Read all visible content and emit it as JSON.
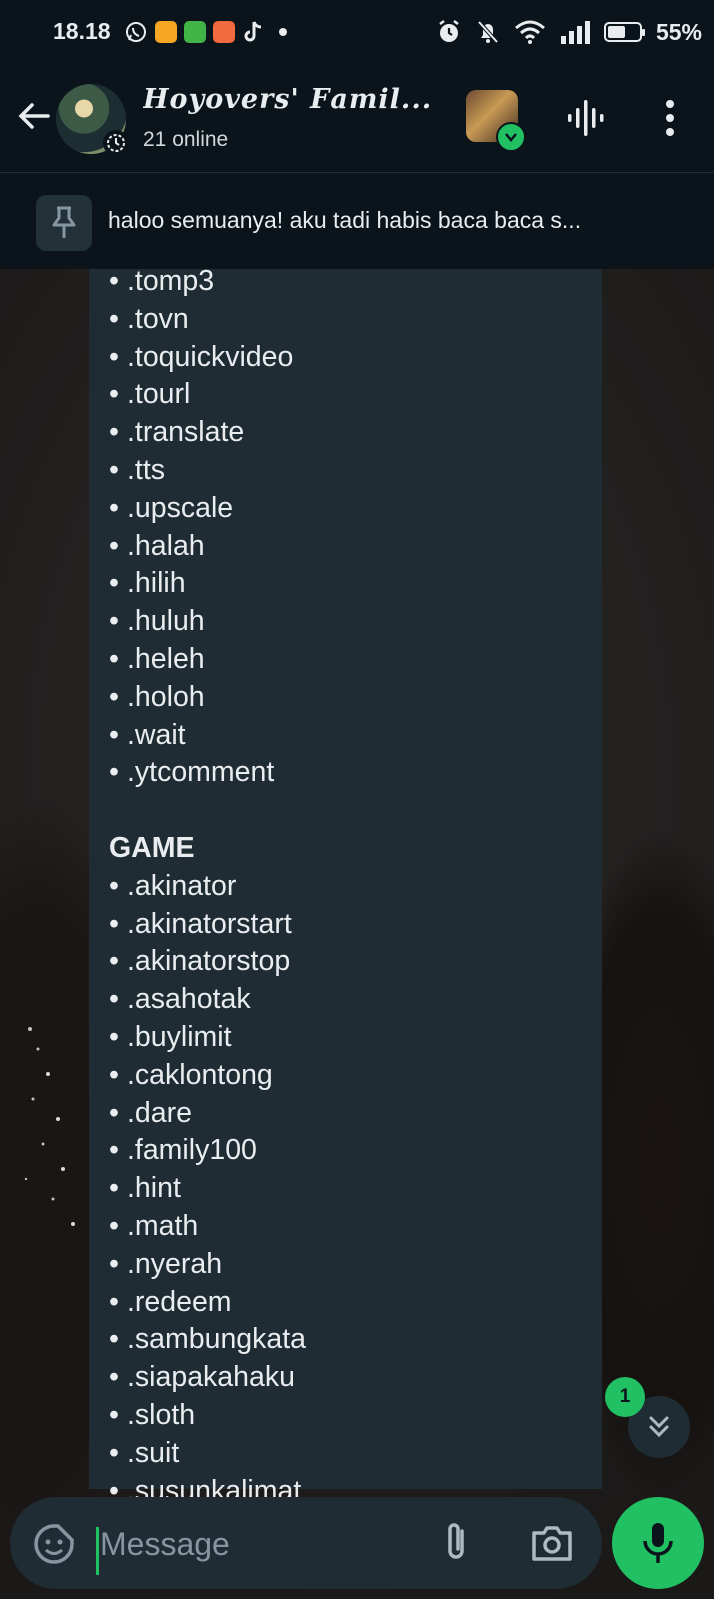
{
  "status_bar": {
    "time": "18.18",
    "battery": "55%",
    "app_icons": [
      "whatsapp-icon",
      "shopee-icon",
      "tokopedia-icon",
      "game-app-icon",
      "tiktok-icon"
    ],
    "right_icons": [
      "alarm-icon",
      "bell-off-icon",
      "wifi-icon",
      "signal-icon",
      "battery-icon"
    ]
  },
  "header": {
    "title": "𝑯oyovers' 𝑭amil...",
    "subtitle": "21 online"
  },
  "pinned": {
    "text": "haloo semuanya! aku tadi habis baca baca s..."
  },
  "message": {
    "lines": [
      {
        "text": ".tomp3",
        "bullet": "•"
      },
      {
        "text": ".tovn",
        "bullet": "•"
      },
      {
        "text": ".toquickvideo",
        "bullet": "•"
      },
      {
        "text": ".tourl",
        "bullet": "•"
      },
      {
        "text": ".translate",
        "bullet": "•"
      },
      {
        "text": ".tts",
        "bullet": "•"
      },
      {
        "text": ".upscale",
        "bullet": "•"
      },
      {
        "text": ".halah",
        "bullet": "•"
      },
      {
        "text": ".hilih",
        "bullet": "•"
      },
      {
        "text": ".huluh",
        "bullet": "•"
      },
      {
        "text": ".heleh",
        "bullet": "•"
      },
      {
        "text": ".holoh",
        "bullet": "•"
      },
      {
        "text": ".wait",
        "bullet": "•"
      },
      {
        "text": ".ytcomment",
        "bullet": "•"
      },
      {
        "text": "",
        "bullet": ""
      },
      {
        "text": "GAME",
        "bullet": "",
        "heading": true
      },
      {
        "text": ".akinator",
        "bullet": "•"
      },
      {
        "text": ".akinatorstart",
        "bullet": "•"
      },
      {
        "text": ".akinatorstop",
        "bullet": "•"
      },
      {
        "text": ".asahotak",
        "bullet": "•"
      },
      {
        "text": ".buylimit",
        "bullet": "•"
      },
      {
        "text": ".caklontong",
        "bullet": "•"
      },
      {
        "text": ".dare",
        "bullet": "•"
      },
      {
        "text": ".family100",
        "bullet": "•"
      },
      {
        "text": ".hint",
        "bullet": "•"
      },
      {
        "text": ".math",
        "bullet": "•"
      },
      {
        "text": ".nyerah",
        "bullet": "•"
      },
      {
        "text": ".redeem",
        "bullet": "•"
      },
      {
        "text": ".sambungkata",
        "bullet": "•"
      },
      {
        "text": ".siapakahaku",
        "bullet": "•"
      },
      {
        "text": ".sloth",
        "bullet": "•"
      },
      {
        "text": ".suit",
        "bullet": "•"
      },
      {
        "text": ".susunkalimat",
        "bullet": "•"
      }
    ]
  },
  "scroll_button": {
    "unread_count": "1"
  },
  "composer": {
    "placeholder": "Message"
  },
  "colors": {
    "accent": "#21c063",
    "background": "#0b141a",
    "bubble": "#1f2c34"
  }
}
